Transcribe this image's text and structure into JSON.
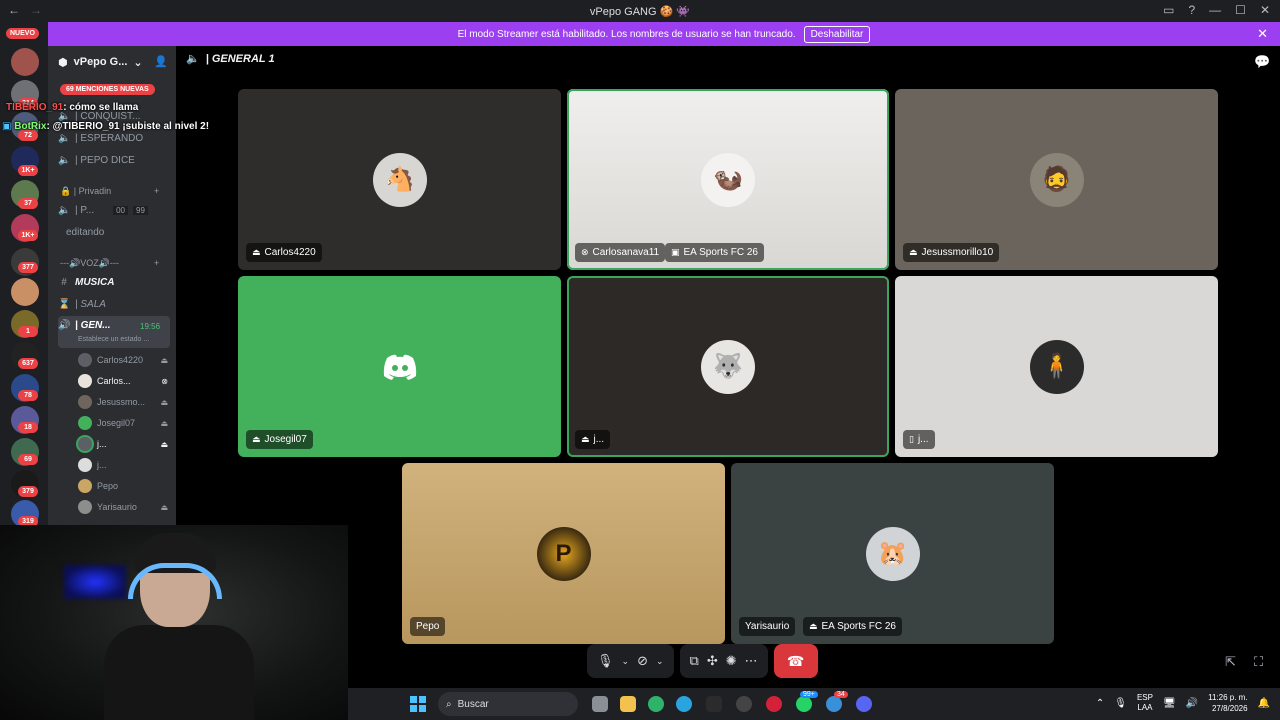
{
  "window": {
    "title": "vPepo GANG",
    "title_emoji": "🍪 👾"
  },
  "banner": {
    "text": "El modo Streamer está habilitado. Los nombres de usuario se han truncado.",
    "button": "Deshabilitar"
  },
  "rail": {
    "nuevo": "NUEVO",
    "badges": [
      "314",
      "72",
      "1K+",
      "37",
      "1K+",
      "377",
      "1",
      "637",
      "78",
      "18",
      "69",
      "379",
      "319"
    ]
  },
  "server": {
    "name": "vPepo G...",
    "mentions": "69 MENCIONES NUEVAS",
    "channels": [
      {
        "label": "| CONQUIST...",
        "icon": "speaker-icon"
      },
      {
        "label": "| ESPERANDO",
        "icon": "speaker-icon"
      },
      {
        "label": "| PEPO DICE",
        "icon": "speaker-icon"
      }
    ],
    "category_private": "| Privadin",
    "private_channel": "| P...",
    "private_counts": [
      "00",
      "99"
    ],
    "editing": "editando",
    "category_voice": "---🔊VOZ🔊---",
    "voice_channels": [
      {
        "label": "MUSICA",
        "icon": "hash-icon"
      },
      {
        "label": "| SALA",
        "icon": "hourglass-icon"
      }
    ],
    "active_channel": "| GEN...",
    "active_timer": "19:56",
    "active_status": "Establece un estado ...",
    "voice_users": [
      "Carlos4220",
      "Carlos...",
      "Jesussmo...",
      "Josegil07",
      "j...",
      "j...",
      "Pepo",
      "Yarisaurio"
    ]
  },
  "chat": [
    {
      "user": "TIBERIO_91",
      "text": ": cómo se llama"
    },
    {
      "user": "BotRix",
      "text": ": @TIBERIO_91 ¡subiste al nivel 2!"
    }
  ],
  "voice": {
    "channel_title": "| GENERAL 1",
    "tiles": [
      {
        "name": "Carlos4220",
        "platform": "ps",
        "activity": ""
      },
      {
        "name": "Carlosanava11",
        "platform": "xbox",
        "activity": "EA Sports FC 26"
      },
      {
        "name": "Jesussmorillo10",
        "platform": "ps",
        "activity": ""
      },
      {
        "name": "Josegil07",
        "platform": "ps",
        "activity": ""
      },
      {
        "name": "j...",
        "platform": "ps",
        "activity": ""
      },
      {
        "name": "j...",
        "platform": "mobile",
        "activity": ""
      },
      {
        "name": "Pepo",
        "platform": "",
        "activity": ""
      },
      {
        "name": "Yarisaurio",
        "platform": "ps",
        "activity": "EA Sports FC 26"
      }
    ]
  },
  "taskbar": {
    "search_placeholder": "Buscar",
    "lang1": "ESP",
    "lang2": "LAA",
    "time": "11:26 p. m.",
    "date": "27/8/2026",
    "badge_whatsapp": "99+",
    "badge_telegram": "34"
  },
  "colors": {
    "accent": "#9b3ff0",
    "discord_green": "#43b05c",
    "speaking": "#3ba55d",
    "hangup": "#da373c"
  }
}
